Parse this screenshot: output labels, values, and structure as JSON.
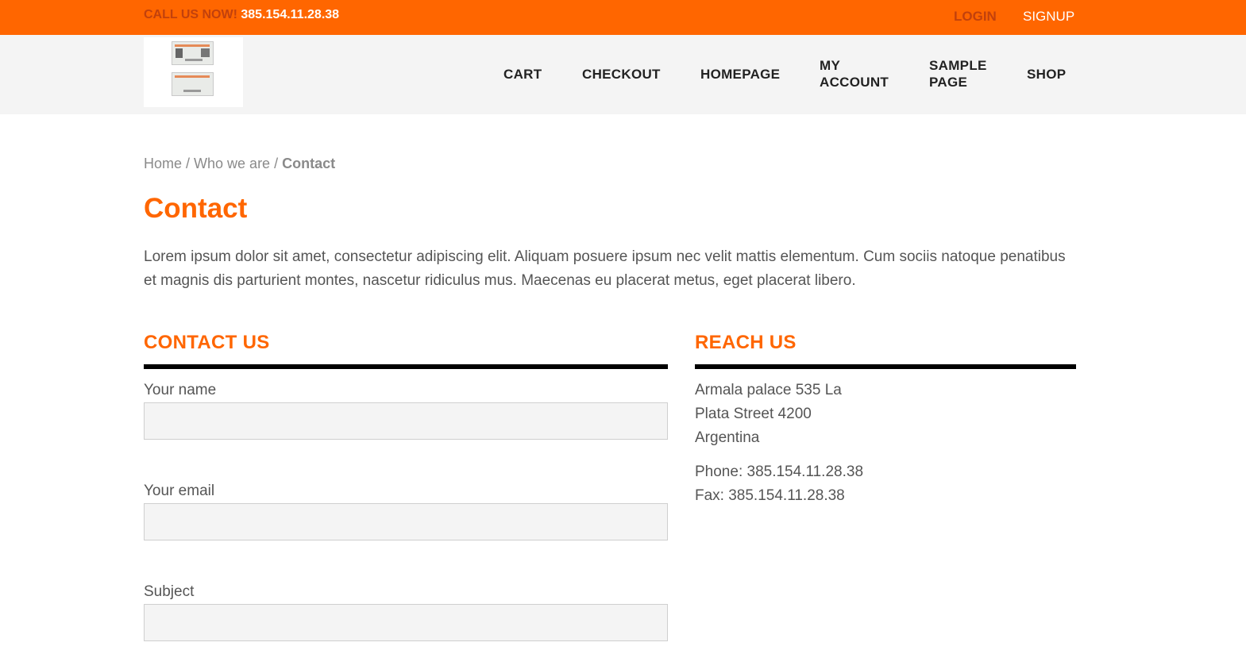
{
  "topbar": {
    "call_label": "CALL US NOW!",
    "phone": "385.154.11.28.38",
    "login": "LOGIN",
    "signup": "SIGNUP",
    "bg_color": "#ff6600"
  },
  "nav": {
    "items": [
      {
        "line1": "CART",
        "line2": ""
      },
      {
        "line1": "CHECKOUT",
        "line2": ""
      },
      {
        "line1": "HOMEPAGE",
        "line2": ""
      },
      {
        "line1": "MY",
        "line2": "ACCOUNT"
      },
      {
        "line1": "SAMPLE",
        "line2": "PAGE"
      },
      {
        "line1": "SHOP",
        "line2": ""
      }
    ]
  },
  "breadcrumb": {
    "home": "Home",
    "sep1": " / ",
    "parent": "Who we are",
    "sep2": " / ",
    "current": "Contact"
  },
  "page": {
    "title": "Contact",
    "intro": "Lorem ipsum dolor sit amet, consectetur adipiscing elit. Aliquam posuere ipsum nec velit mattis elementum. Cum sociis natoque penatibus et magnis dis parturient montes, nascetur ridiculus mus. Maecenas eu placerat metus, eget placerat libero."
  },
  "contact_form": {
    "heading": "CONTACT US",
    "fields": [
      {
        "label": "Your name",
        "value": ""
      },
      {
        "label": "Your email",
        "value": ""
      },
      {
        "label": "Subject",
        "value": ""
      }
    ]
  },
  "reach_us": {
    "heading": "REACH US",
    "address": [
      "Armala palace 535 La",
      "Plata Street 4200",
      "Argentina"
    ],
    "phone": "Phone: 385.154.11.28.38",
    "fax": "Fax: 385.154.11.28.38"
  },
  "colors": {
    "accent": "#ff6600",
    "header_bg": "#f4f4f4",
    "rule": "#000000"
  }
}
